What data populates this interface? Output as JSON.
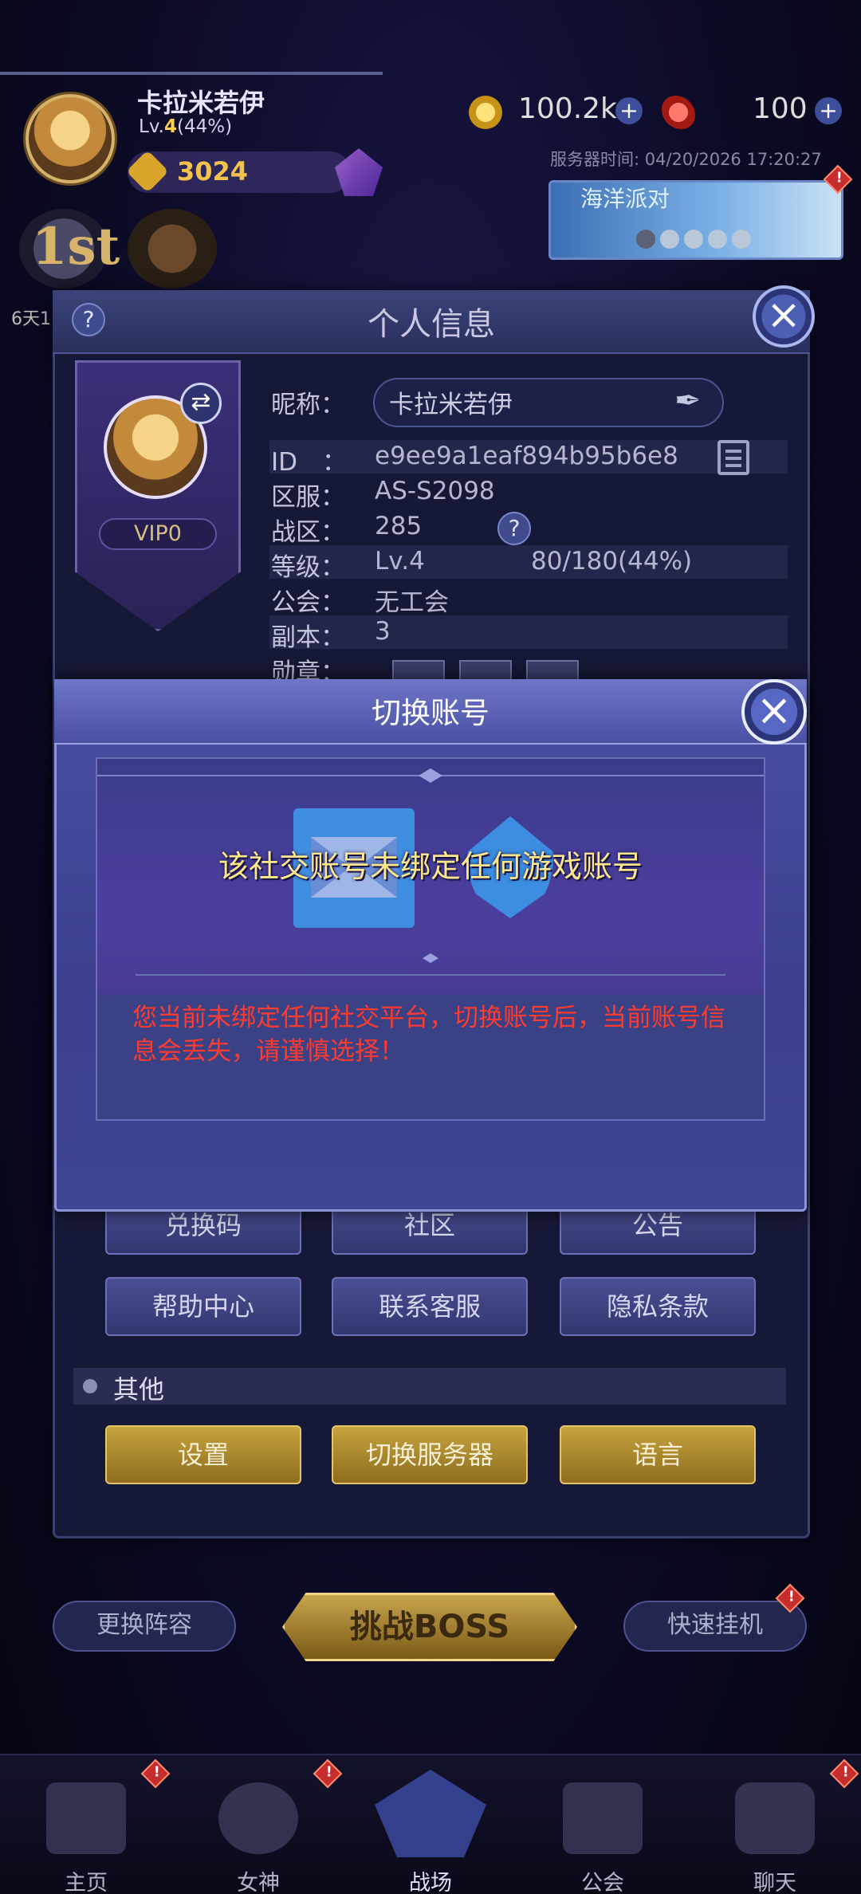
{
  "hud": {
    "player_name": "卡拉米若伊",
    "level_prefix": "Lv.",
    "level_num": "4",
    "level_pct": "(44%)",
    "power": "3024",
    "coins": "100.2k",
    "gems": "100",
    "server_time": "服务器时间: 04/20/2026 17:20:27",
    "event_title": "海洋派对",
    "rank_text": "1st",
    "left_caption": "6天1"
  },
  "profile_panel": {
    "title": "个人信息",
    "vip": "VIP0",
    "rows": {
      "nickname_label": "昵称：",
      "nickname_value": "卡拉米若伊",
      "id_label": "ID　：",
      "id_value": "e9ee9a1eaf894b95b6e8",
      "zone_label": "区服：",
      "zone_value": "AS-S2098",
      "war_label": "战区：",
      "war_value": "285",
      "level_label": "等级：",
      "level_value": "Lv.4",
      "level_exp": "80/180(44%)",
      "guild_label": "公会：",
      "guild_value": "无工会",
      "dungeon_label": "副本：",
      "dungeon_value": "3",
      "medal_label": "勋章："
    },
    "buttons_row1": [
      "兑换码",
      "社区",
      "公告"
    ],
    "buttons_row2": [
      "帮助中心",
      "联系客服",
      "隐私条款"
    ],
    "other_section": "其他",
    "buttons_row3": [
      "设置",
      "切换服务器",
      "语言"
    ]
  },
  "dialog": {
    "title": "切换账号",
    "message": "该社交账号未绑定任何游戏账号",
    "warning": "您当前未绑定任何社交平台，切换账号后，当前账号信息会丢失，请谨慎选择！"
  },
  "bottom": {
    "left_pill": "更换阵容",
    "boss": "挑战BOSS",
    "right_pill": "快速挂机",
    "nav": [
      "主页",
      "女神",
      "战场",
      "公会",
      "聊天"
    ]
  },
  "colors": {
    "accent_gold": "#f3c24c",
    "warning_red": "#ff3b30",
    "message_yellow": "#ffe88c"
  }
}
